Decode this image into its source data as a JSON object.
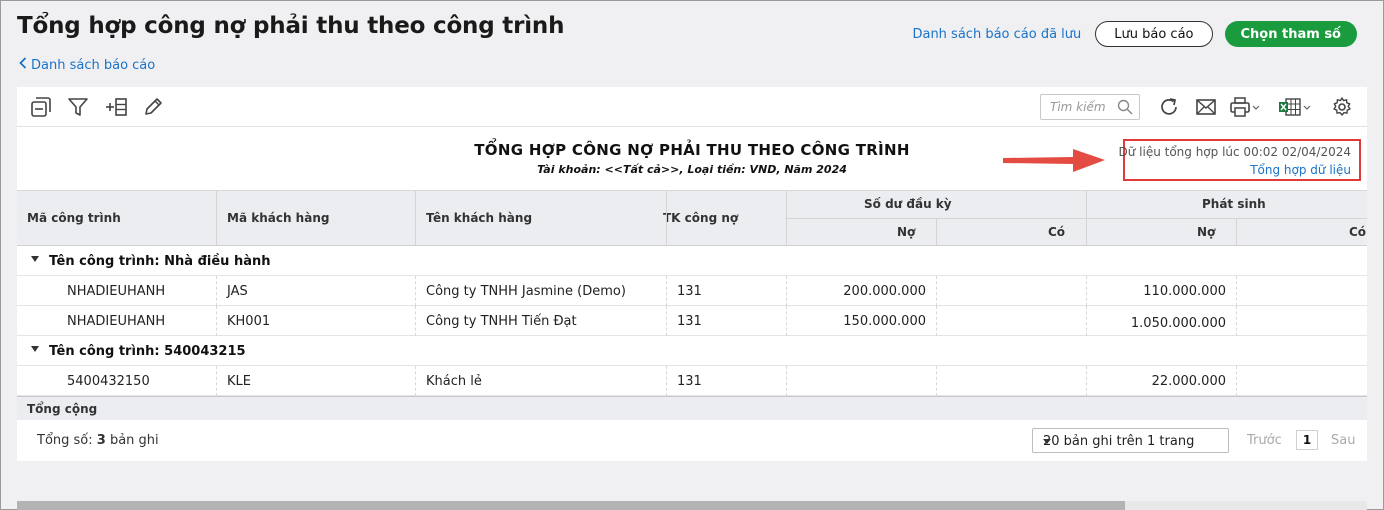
{
  "header": {
    "title": "Tổng hợp công nợ phải thu theo công trình",
    "back_link": "Danh sách báo cáo",
    "saved_reports_link": "Danh sách báo cáo đã lưu",
    "save_button": "Lưu báo cáo",
    "choose_params_button": "Chọn tham số",
    "accent_color": "#1a9c3e",
    "link_color": "#1a73c8"
  },
  "toolbar": {
    "icons": [
      "collapse-icon",
      "filter-icon",
      "add-column-icon",
      "edit-icon",
      "refresh-icon",
      "email-icon",
      "print-icon",
      "excel-icon",
      "settings-icon"
    ],
    "search_placeholder": "Tìm kiếm"
  },
  "report": {
    "title": "TỔNG HỢP CÔNG NỢ PHẢI THU THEO CÔNG TRÌNH",
    "subtitle": "Tài khoản: <<Tất cả>>, Loại tiền: VND, Năm 2024",
    "sync_time": "Dữ liệu tổng hợp lúc 00:02 02/04/2024",
    "sync_link": "Tổng hợp dữ liệu",
    "highlight_color": "#e03a3a"
  },
  "table": {
    "columns": {
      "project_code": "Mã công trình",
      "customer_code": "Mã khách hàng",
      "customer_name": "Tên khách hàng",
      "debt_account": "TK công nợ",
      "opening_balance": "Số dư đầu kỳ",
      "incurred": "Phát sinh",
      "debit": "Nợ",
      "credit": "Có"
    },
    "groups": [
      {
        "label": "Tên công trình: Nhà điều hành",
        "rows": [
          {
            "project_code": "NHADIEUHANH",
            "customer_code": "JAS",
            "customer_name": "Công ty TNHH Jasmine (Demo)",
            "account": "131",
            "open_debit": "200.000.000",
            "open_credit": "",
            "inc_debit": "110.000.000"
          },
          {
            "project_code": "NHADIEUHANH",
            "customer_code": "KH001",
            "customer_name": "Công ty TNHH Tiến Đạt",
            "account": "131",
            "open_debit": "150.000.000",
            "open_credit": "",
            "inc_debit": "1.050.000.000"
          }
        ]
      },
      {
        "label": "Tên công trình: 540043215",
        "rows": [
          {
            "project_code": "5400432150",
            "customer_code": "KLE",
            "customer_name": "Khách lẻ",
            "account": "131",
            "open_debit": "",
            "open_credit": "",
            "inc_debit": "22.000.000"
          }
        ]
      }
    ],
    "total_label": "Tổng cộng"
  },
  "footer": {
    "records_prefix": "Tổng số: ",
    "records_count": "3",
    "records_suffix": " bản ghi",
    "page_size_option": "20 bản ghi trên 1 trang",
    "prev": "Trước",
    "page": "1",
    "next": "Sau"
  }
}
